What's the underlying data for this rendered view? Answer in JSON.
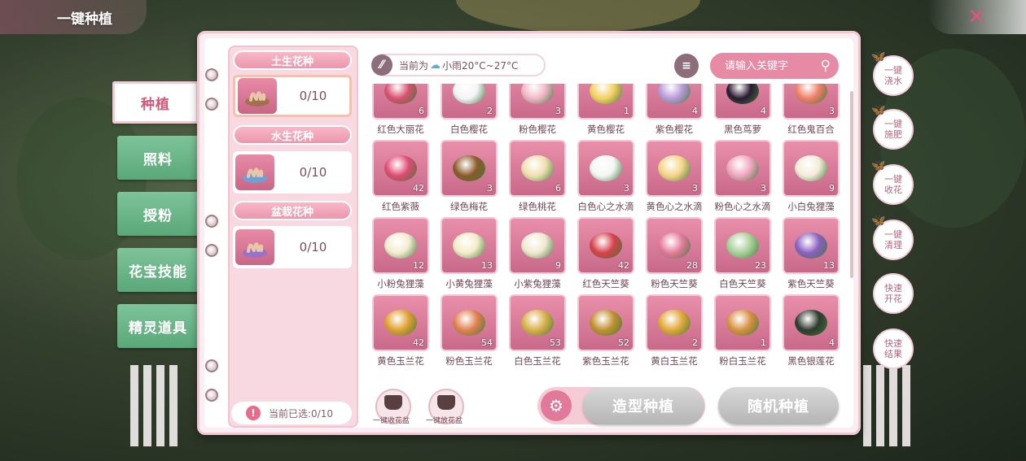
{
  "header": {
    "title": "一键种植",
    "close_icon": "flower-close-icon"
  },
  "tabs": [
    {
      "label": "种植",
      "active": true
    },
    {
      "label": "照料",
      "active": false
    },
    {
      "label": "授粉",
      "active": false
    },
    {
      "label": "花宝技能",
      "active": false
    },
    {
      "label": "精灵道具",
      "active": false
    }
  ],
  "seed_types": [
    {
      "header": "土生花种",
      "count": "0/10",
      "active": true
    },
    {
      "header": "水生花种",
      "count": "0/10",
      "active": false
    },
    {
      "header": "盆栽花种",
      "count": "0/10",
      "active": false
    }
  ],
  "selected": {
    "text": "当前已选:0/10"
  },
  "weather": {
    "prefix": "当前为",
    "condition": "小雨20°C~27°C"
  },
  "search": {
    "placeholder": "请输入关键字"
  },
  "flowers": [
    {
      "name": "红色大丽花",
      "count": "6",
      "color": "#d8506e"
    },
    {
      "name": "白色樱花",
      "count": "2",
      "color": "#f4f4f8"
    },
    {
      "name": "粉色樱花",
      "count": "3",
      "color": "#f3b6c8"
    },
    {
      "name": "黄色樱花",
      "count": "1",
      "color": "#f3d060"
    },
    {
      "name": "紫色樱花",
      "count": "4",
      "color": "#b99ad8"
    },
    {
      "name": "黑色茑萝",
      "count": "4",
      "color": "#2a1a30"
    },
    {
      "name": "红色鬼百合",
      "count": "3",
      "color": "#f07e68"
    },
    {
      "name": "红色紫薇",
      "count": "42",
      "color": "#e04a72"
    },
    {
      "name": "绿色梅花",
      "count": "3",
      "color": "#8a5a2a"
    },
    {
      "name": "绿色桃花",
      "count": "6",
      "color": "#f0e0b0"
    },
    {
      "name": "白色心之水滴",
      "count": "3",
      "color": "#f4f6f4"
    },
    {
      "name": "黄色心之水滴",
      "count": "3",
      "color": "#f4d488"
    },
    {
      "name": "粉色心之水滴",
      "count": "3",
      "color": "#f0a6c0"
    },
    {
      "name": "小白兔狸藻",
      "count": "9",
      "color": "#f4ecd8"
    },
    {
      "name": "小粉兔狸藻",
      "count": "12",
      "color": "#f4ecd0"
    },
    {
      "name": "小黄兔狸藻",
      "count": "13",
      "color": "#f4ecc8"
    },
    {
      "name": "小紫兔狸藻",
      "count": "9",
      "color": "#f0e8d0"
    },
    {
      "name": "红色天竺葵",
      "count": "42",
      "color": "#d6404a"
    },
    {
      "name": "粉色天竺葵",
      "count": "28",
      "color": "#e47a9a"
    },
    {
      "name": "白色天竺葵",
      "count": "23",
      "color": "#a8d098"
    },
    {
      "name": "紫色天竺葵",
      "count": "13",
      "color": "#8a60c0"
    },
    {
      "name": "黄色玉兰花",
      "count": "42",
      "color": "#e0a030"
    },
    {
      "name": "粉色玉兰花",
      "count": "54",
      "color": "#e08050"
    },
    {
      "name": "白色玉兰花",
      "count": "53",
      "color": "#d8b048"
    },
    {
      "name": "紫色玉兰花",
      "count": "52",
      "color": "#c09030"
    },
    {
      "name": "黄白玉兰花",
      "count": "2",
      "color": "#e0a838"
    },
    {
      "name": "粉白玉兰花",
      "count": "1",
      "color": "#d89040"
    },
    {
      "name": "黑色银莲花",
      "count": "4",
      "color": "#2e3a2e"
    }
  ],
  "pot_buttons": [
    {
      "label": "一键收花盆"
    },
    {
      "label": "一键放花盆"
    }
  ],
  "actions": {
    "shape_plant": "造型种植",
    "random_plant": "随机种植"
  },
  "quick_actions": [
    {
      "label": "一键浇水"
    },
    {
      "label": "一键施肥"
    },
    {
      "label": "一键收花"
    },
    {
      "label": "一键清理"
    },
    {
      "label": "快速开花"
    },
    {
      "label": "快速结果"
    }
  ]
}
